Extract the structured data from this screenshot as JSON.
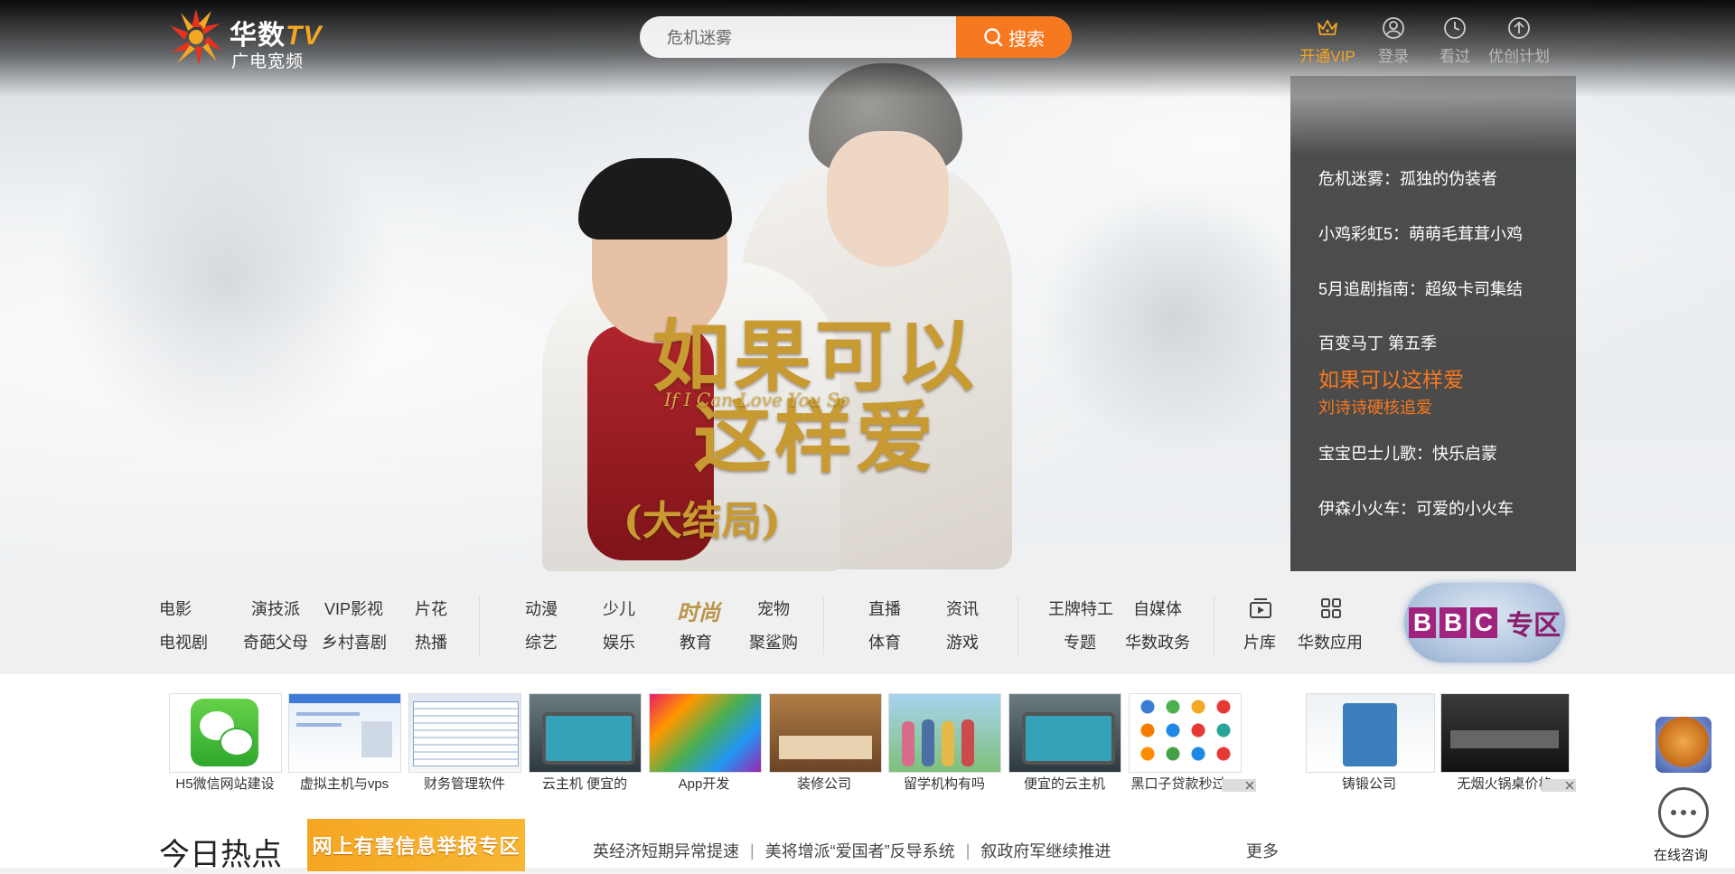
{
  "brand": {
    "name": "华数",
    "name_tv": "TV",
    "subtitle": "广电宽频"
  },
  "search": {
    "value": "危机迷雾",
    "button_label": "搜索"
  },
  "topnav": [
    {
      "label": "开通VIP",
      "icon": "crown-icon"
    },
    {
      "label": "登录",
      "icon": "user-icon"
    },
    {
      "label": "看过",
      "icon": "clock-icon"
    },
    {
      "label": "优创计划",
      "icon": "upload-icon"
    }
  ],
  "hero": {
    "title_cn": "如果可以这样爱",
    "title_en": "If I Can Love You So",
    "badge": "(大结局)"
  },
  "playlist": [
    {
      "title": "危机迷雾：孤独的伪装者"
    },
    {
      "title": "小鸡彩虹5：萌萌毛茸茸小鸡"
    },
    {
      "title": "5月追剧指南：超级卡司集结"
    },
    {
      "title": "百变马丁 第五季"
    },
    {
      "title": "如果可以这样爱",
      "subtitle": "刘诗诗硬核追爱",
      "active": true
    },
    {
      "title": "宝宝巴士儿歌：快乐启蒙"
    },
    {
      "title": "伊森小火车：可爱的小火车"
    }
  ],
  "categories": {
    "group1": [
      "电影",
      "演技派",
      "VIP影视",
      "片花",
      "电视剧",
      "奇葩父母",
      "乡村喜剧",
      "热播"
    ],
    "group2": [
      "动漫",
      "少儿",
      "宠物",
      "综艺",
      "娱乐",
      "教育",
      "聚鲨购"
    ],
    "fashion": "时尚",
    "group3": [
      "直播",
      "资讯",
      "体育",
      "游戏"
    ],
    "group4": [
      "王牌特工",
      "自媒体",
      "专题",
      "华数政务"
    ],
    "group5": [
      {
        "label": "片库",
        "icon": "video-library-icon"
      },
      {
        "label": "华数应用",
        "icon": "apps-grid-icon"
      }
    ],
    "bbc_letters": [
      "B",
      "B",
      "C"
    ],
    "bbc_zone": "专区"
  },
  "ads": [
    "H5微信网站建设",
    "虚拟主机与vps",
    "财务管理软件",
    "云主机 便宜的",
    "App开发",
    "装修公司",
    "留学机构有吗",
    "便宜的云主机",
    "黑口子贷款秒过",
    "铸锻公司",
    "无烟火锅桌价格"
  ],
  "hot": {
    "title": "今日热点",
    "banner": "网上有害信息举报专区",
    "news": [
      "英经济短期异常提速",
      "美将增派“爱国者”反导系统",
      "叙政府军继续推进"
    ],
    "more": "更多"
  },
  "float": {
    "chat_label": "在线咨询"
  },
  "colors": {
    "accent": "#f6781f",
    "vip": "#f5a623",
    "bbc": "#a0237e"
  }
}
